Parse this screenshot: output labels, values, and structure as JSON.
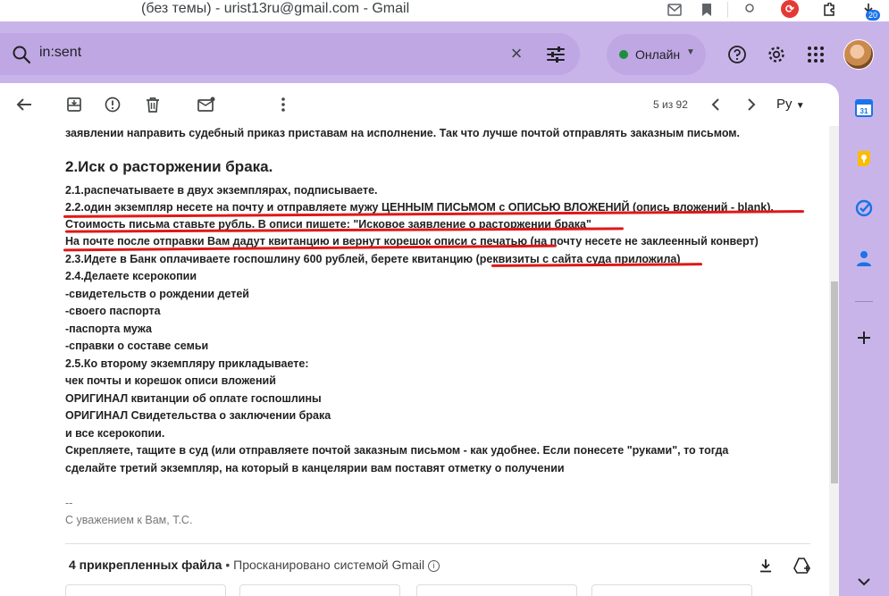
{
  "window": {
    "title": "(без темы) - urist13ru@gmail.com - Gmail",
    "download_badge": "20"
  },
  "search": {
    "query": "in:sent"
  },
  "header": {
    "status_label": "Онлайн"
  },
  "toolbar": {
    "pager": "5 из 92",
    "language": "Ру"
  },
  "message": {
    "intro_line": "заявлении направить судебный приказ приставам на исполнение. Так что лучше почтой отправлять заказным письмом.",
    "section_title": "2.Иск о расторжении брака.",
    "lines": [
      "2.1.распечатываете в двух экземплярах, подписываете.",
      "2.2.один экземпляр несете на почту и отправляете мужу ЦЕННЫМ ПИСЬМОМ с ОПИСЬЮ ВЛОЖЕНИЙ (опись вложений - blank).",
      "Стоимость письма ставьте рубль. В описи пишете: \"Исковое заявление о расторжении брака\"",
      "На почте после отправки Вам дадут квитанцию и вернут корешок описи с печатью (на почту несете не заклеенный конверт)",
      "2.3.Идете в Банк оплачиваете госпошлину 600 рублей, берете квитанцию (реквизиты с сайта суда приложила)",
      "2.4.Делаете ксерокопии",
      "-свидетельств о рождении детей",
      "-своего паспорта",
      "-паспорта мужа",
      "-справки о составе семьи",
      "2.5.Ко второму экземпляру прикладываете:",
      "чек почты и корешок описи вложений",
      "ОРИГИНАЛ квитанции об оплате госпошлины",
      "ОРИГИНАЛ Свидетельства о заключении брака",
      "и все ксерокопии.",
      "Скрепляете, тащите в суд (или отправляете почтой заказным письмом - как удобнее. Если понесете \"руками\", то тогда",
      "сделайте третий экземпляр, на который в канцелярии вам поставят отметку о получении"
    ],
    "signature_dash": "--",
    "signature": "С уважением к Вам, Т.С."
  },
  "attachments": {
    "count_label": "4 прикрепленных файла",
    "scan_note": " • Просканировано системой Gmail"
  },
  "side_panel": {
    "calendar_day": "31"
  },
  "colors": {
    "background": "#c9b4ea",
    "underline": "#e01818",
    "online": "#1e8e3e"
  }
}
